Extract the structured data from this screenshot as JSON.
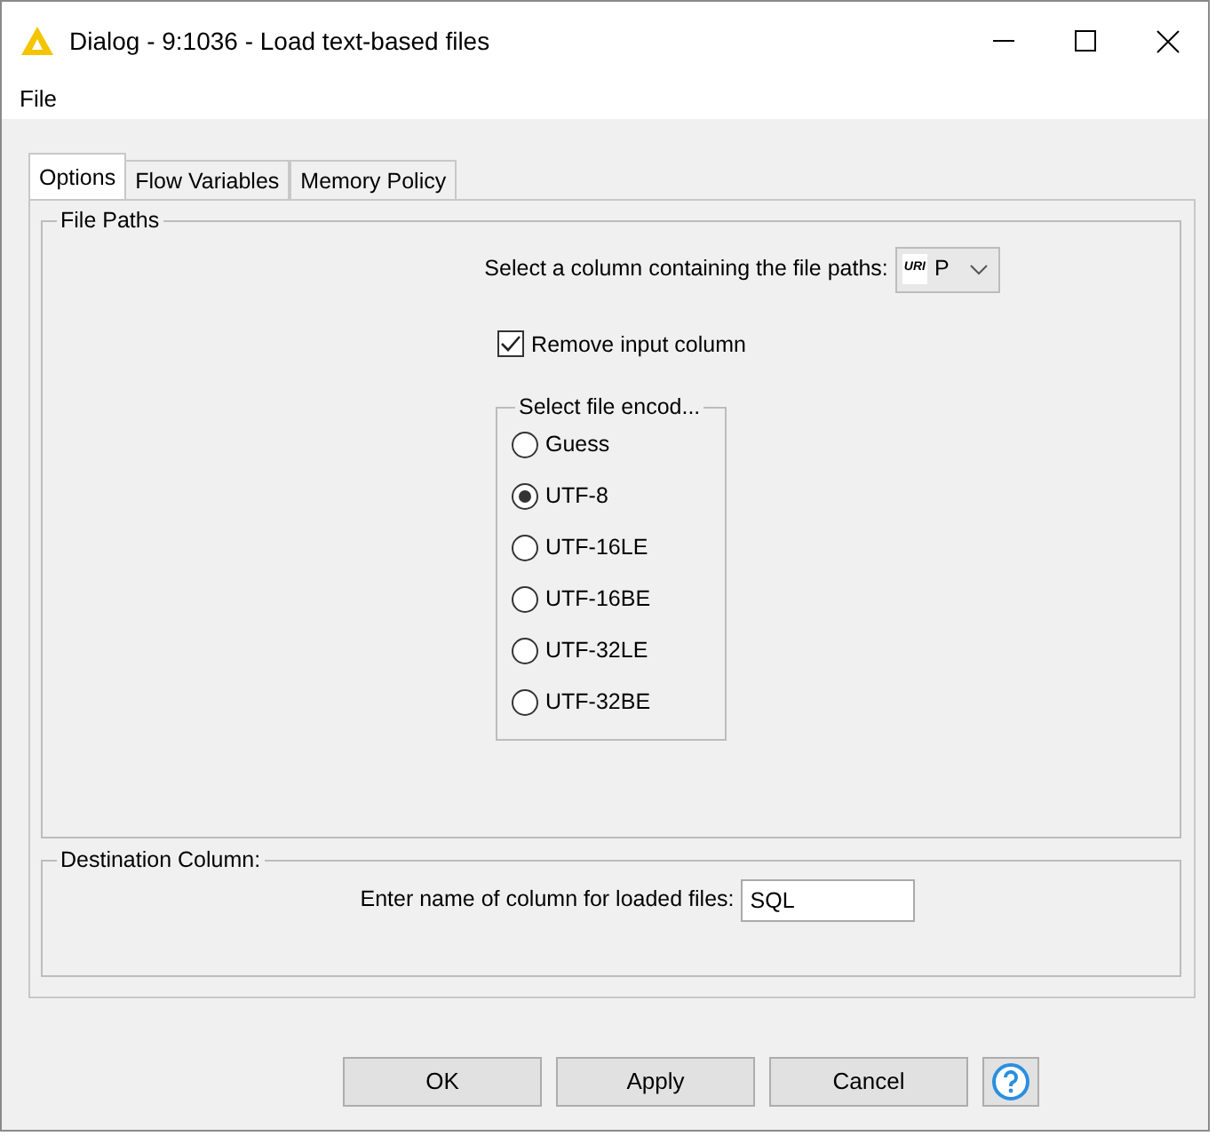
{
  "window": {
    "title": "Dialog - 9:1036 - Load text-based files"
  },
  "menu": [
    "File"
  ],
  "tabs": [
    {
      "label": "Options",
      "selected": true
    },
    {
      "label": "Flow Variables",
      "selected": false
    },
    {
      "label": "Memory Policy",
      "selected": false
    }
  ],
  "file_paths": {
    "title": "File Paths",
    "column_label": "Select a column containing the file paths:",
    "column_type": "URI",
    "column_value": "P",
    "remove_input": {
      "label": "Remove input column",
      "checked": true
    },
    "encoding": {
      "title": "Select file encod...",
      "options": [
        {
          "label": "Guess",
          "selected": false
        },
        {
          "label": "UTF-8",
          "selected": true
        },
        {
          "label": "UTF-16LE",
          "selected": false
        },
        {
          "label": "UTF-16BE",
          "selected": false
        },
        {
          "label": "UTF-32LE",
          "selected": false
        },
        {
          "label": "UTF-32BE",
          "selected": false
        }
      ]
    }
  },
  "destination": {
    "title": "Destination Column:",
    "label": "Enter name of column for loaded files:",
    "value": "SQL"
  },
  "buttons": [
    "OK",
    "Apply",
    "Cancel"
  ]
}
